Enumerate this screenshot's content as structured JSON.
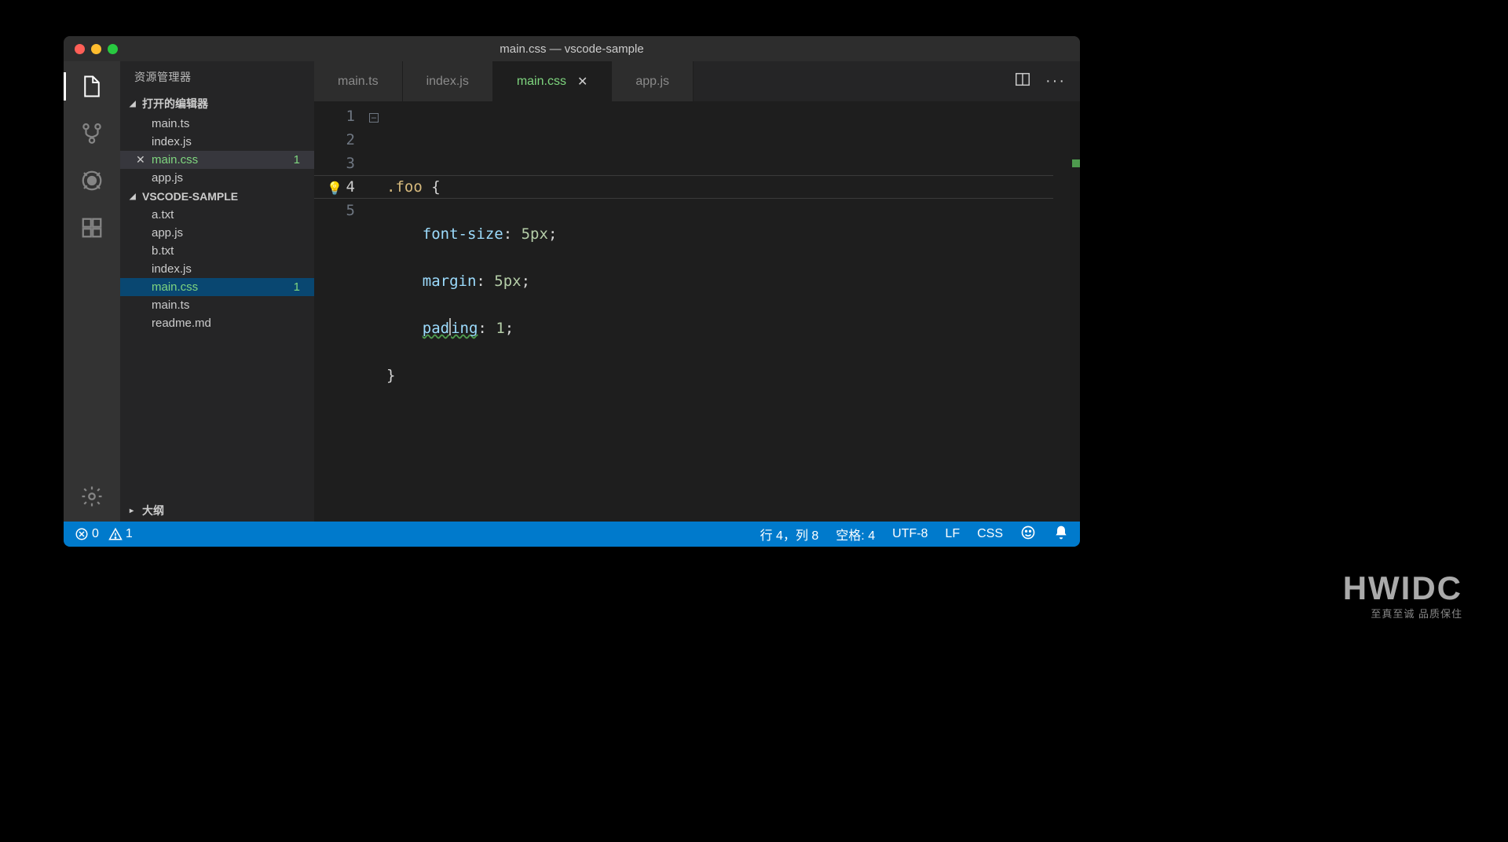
{
  "title": "main.css — vscode-sample",
  "sidebar": {
    "title": "资源管理器",
    "openEditorsLabel": "打开的编辑器",
    "openEditors": [
      {
        "name": "main.ts"
      },
      {
        "name": "index.js"
      },
      {
        "name": "main.css",
        "modified": true,
        "badge": "1",
        "active": true
      },
      {
        "name": "app.js"
      }
    ],
    "projectLabel": "VSCODE-SAMPLE",
    "files": [
      {
        "name": "a.txt"
      },
      {
        "name": "app.js"
      },
      {
        "name": "b.txt"
      },
      {
        "name": "index.js"
      },
      {
        "name": "main.css",
        "modified": true,
        "badge": "1",
        "selected": true
      },
      {
        "name": "main.ts"
      },
      {
        "name": "readme.md"
      }
    ],
    "outlineLabel": "大纲"
  },
  "tabs": [
    {
      "name": "main.ts"
    },
    {
      "name": "index.js"
    },
    {
      "name": "main.css",
      "active": true,
      "modified": true
    },
    {
      "name": "app.js"
    }
  ],
  "code": {
    "lines": [
      "1",
      "2",
      "3",
      "4",
      "5"
    ],
    "line1_sel": ".foo",
    "line1_brace": " {",
    "line2_prop": "font-size",
    "line2_val": "5px",
    "line3_prop": "margin",
    "line3_val": "5px",
    "line4_prop_a": "pad",
    "line4_prop_b": "ing",
    "line4_val": "1",
    "line5": "}"
  },
  "status": {
    "errors": "0",
    "warnings": "1",
    "cursor": "行 4，列 8",
    "spaces": "空格: 4",
    "encoding": "UTF-8",
    "eol": "LF",
    "lang": "CSS"
  },
  "watermark": {
    "big": "HWIDC",
    "small": "至真至诚 品质保住"
  }
}
